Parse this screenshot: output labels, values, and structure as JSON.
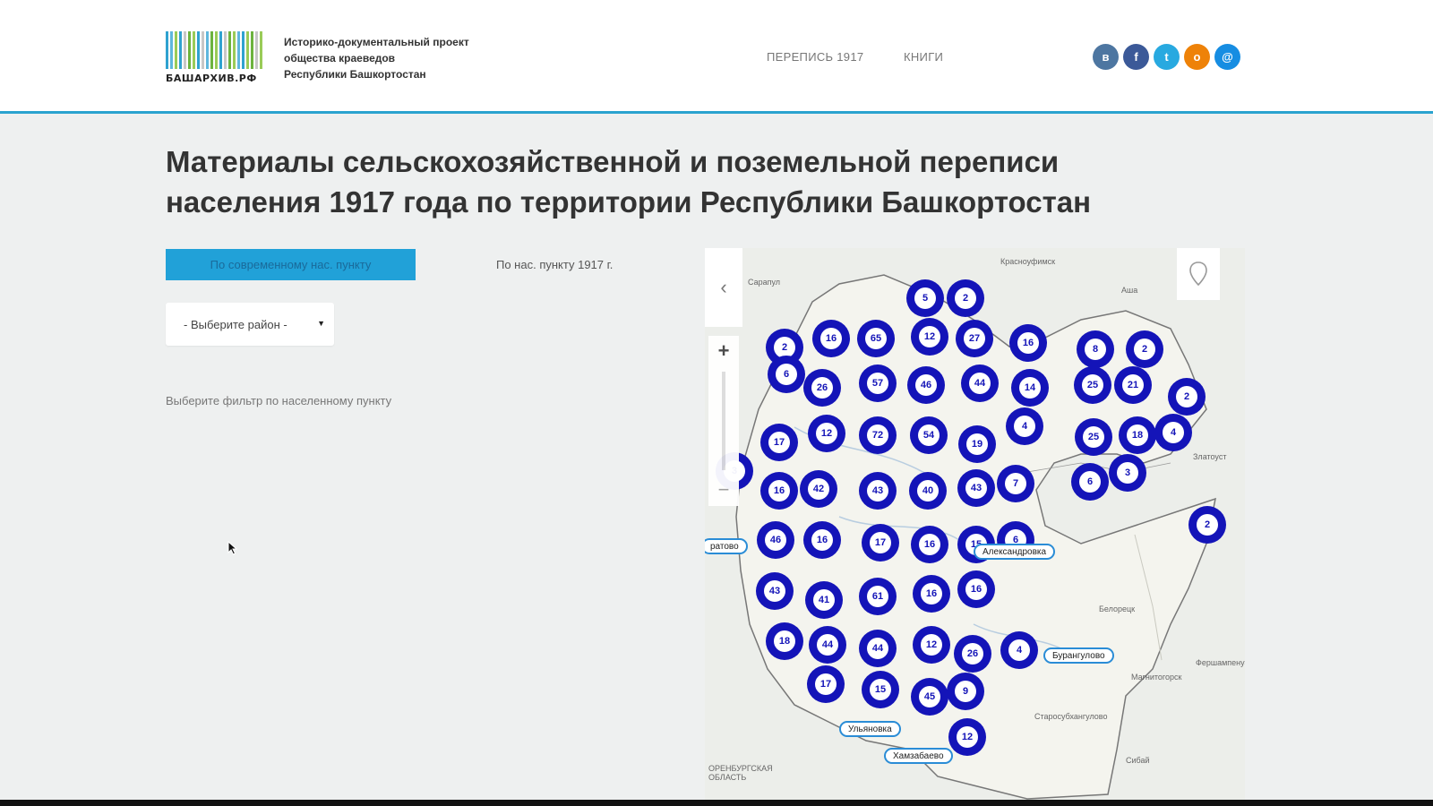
{
  "header": {
    "logo_text": "БАШАРХИВ.РФ",
    "tagline": [
      "Историко-документальный проект",
      "общества краеведов",
      "Республики Башкортостан"
    ],
    "nav": [
      "ПЕРЕПИСЬ 1917",
      "КНИГИ"
    ],
    "social": [
      {
        "name": "vk",
        "glyph": "в",
        "color": "#4d76a1"
      },
      {
        "name": "facebook",
        "glyph": "f",
        "color": "#3b5998"
      },
      {
        "name": "twitter",
        "glyph": "t",
        "color": "#28a9e0"
      },
      {
        "name": "odnoklassniki",
        "glyph": "о",
        "color": "#ee8208"
      },
      {
        "name": "mail",
        "glyph": "@",
        "color": "#168de2"
      }
    ]
  },
  "page": {
    "title": "Материалы сельскохозяйственной и поземельной переписи населения 1917 года по территории Республики Башкортостан",
    "tab_active": "По современному нас. пункту",
    "tab_inactive": "По нас. пункту 1917 г.",
    "district_select": "- Выберите район -",
    "filter_hint": "Выберите фильтр по населенному пункту"
  },
  "map": {
    "labels": [
      {
        "text": "Красноуфимск"
      },
      {
        "text": "Сарапул"
      },
      {
        "text": "Аша"
      },
      {
        "text": "Златоуст"
      },
      {
        "text": "Белорецк"
      },
      {
        "text": "Магнитогорск"
      },
      {
        "text": "Старосубхангулово"
      },
      {
        "text": "Сибай"
      },
      {
        "text": "Фершампенуаз"
      },
      {
        "text": "ОРЕНБУРГСКАЯ ОБЛАСТЬ"
      }
    ],
    "place_tags": [
      "Александровка",
      "Бурангулово",
      "Ульяновка",
      "Хамзабаево",
      "ратово"
    ],
    "clusters": [
      "5",
      "2",
      "2",
      "16",
      "65",
      "12",
      "27",
      "16",
      "8",
      "2",
      "6",
      "26",
      "57",
      "46",
      "44",
      "14",
      "25",
      "21",
      "2",
      "4",
      "17",
      "12",
      "72",
      "54",
      "19",
      "25",
      "18",
      "4",
      "3",
      "16",
      "42",
      "43",
      "40",
      "43",
      "7",
      "6",
      "3",
      "2",
      "46",
      "16",
      "17",
      "16",
      "15",
      "6",
      "43",
      "41",
      "61",
      "16",
      "16",
      "18",
      "44",
      "44",
      "12",
      "26",
      "4",
      "17",
      "15",
      "45",
      "9",
      "12"
    ]
  }
}
